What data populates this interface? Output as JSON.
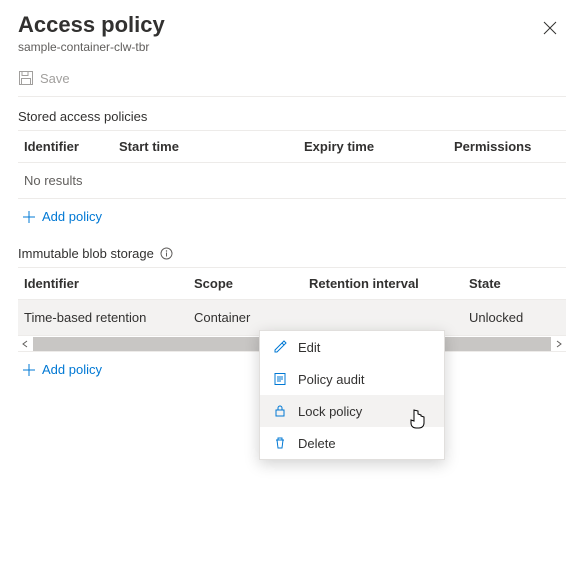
{
  "header": {
    "title": "Access policy",
    "subtitle": "sample-container-clw-tbr"
  },
  "toolbar": {
    "save_label": "Save"
  },
  "stored_access": {
    "section_label": "Stored access policies",
    "columns": {
      "identifier": "Identifier",
      "start_time": "Start time",
      "expiry_time": "Expiry time",
      "permissions": "Permissions"
    },
    "no_results_label": "No results",
    "add_label": "Add policy"
  },
  "immutable": {
    "section_label": "Immutable blob storage",
    "columns": {
      "identifier": "Identifier",
      "scope": "Scope",
      "retention": "Retention interval",
      "state": "State"
    },
    "rows": [
      {
        "identifier": "Time-based retention",
        "scope": "Container",
        "retention": "",
        "state": "Unlocked"
      }
    ],
    "add_label": "Add policy"
  },
  "context_menu": {
    "edit": "Edit",
    "policy_audit": "Policy audit",
    "lock_policy": "Lock policy",
    "delete": "Delete"
  }
}
